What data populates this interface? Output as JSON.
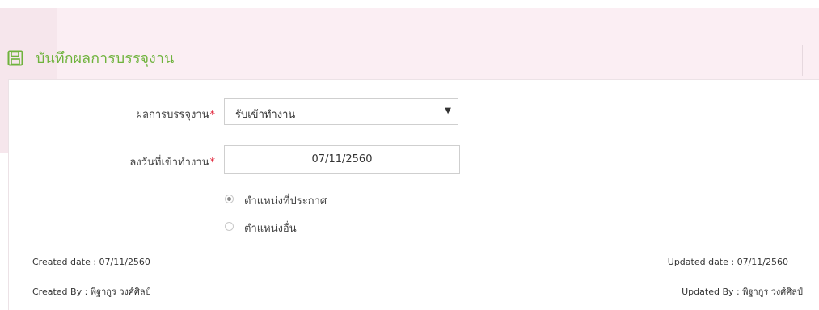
{
  "header": {
    "title": "บันทึกผลการบรรจุงาน",
    "icon": "save-icon",
    "accent_color": "#6fb33d"
  },
  "form": {
    "placement_result": {
      "label": "ผลการบรรจุงาน",
      "required_mark": "*",
      "selected_value": "รับเข้าทำงาน"
    },
    "start_date": {
      "label": "ลงวันที่เข้าทำงาน",
      "required_mark": "*",
      "value": "07/11/2560"
    },
    "position_options": [
      {
        "label": "ตำแหน่งที่ประกาศ",
        "checked": true
      },
      {
        "label": "ตำแหน่งอื่น",
        "checked": false
      }
    ]
  },
  "meta": {
    "created_date": "Created date : 07/11/2560",
    "created_by": "Created By : พิฐากูร วงศ์ศิลป์",
    "updated_date": "Updated date : 07/11/2560",
    "updated_by": "Updated By : พิฐากูร วงศ์ศิลป์"
  }
}
